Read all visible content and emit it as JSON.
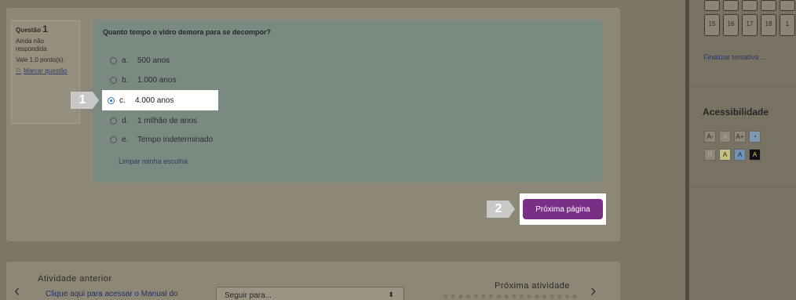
{
  "question": {
    "label": "Questão",
    "number": "1",
    "status": "Ainda não respondida",
    "grade": "Vale 1,0 ponto(s).",
    "flag": "Marcar questão",
    "text": "Quanto tempo o vidro demora para se decompor?",
    "options": [
      {
        "letter": "a.",
        "text": "500 anos",
        "selected": false
      },
      {
        "letter": "b.",
        "text": "1.000 anos",
        "selected": false
      },
      {
        "letter": "c.",
        "text": "4.000 anos",
        "selected": true
      },
      {
        "letter": "d.",
        "text": "1 milhão de anos",
        "selected": false
      },
      {
        "letter": "e.",
        "text": "Tempo indeterminado",
        "selected": false
      }
    ],
    "clear_choice": "Limpar minha escolha"
  },
  "steps": {
    "one": "1",
    "two": "2"
  },
  "next_page_button": "Próxima página",
  "navigation": {
    "prev_title": "Atividade anterior",
    "prev_link": "Clique aqui para acessar o Manual do",
    "goto_placeholder": "Seguir para...",
    "next_title": "Próxima atividade"
  },
  "sidebar": {
    "nav_numbers": [
      "15",
      "16",
      "17",
      "18",
      "1"
    ],
    "finalize": "Finalizar tentativa ...",
    "accessibility_title": "Acessibilidade",
    "acc_row1": [
      "A-",
      "A",
      "A+"
    ],
    "acc_row2": [
      "R",
      "A",
      "A",
      "A"
    ]
  },
  "colors": {
    "accent_purple": "#7a2f86",
    "radio_selected": "#2f6fd6"
  }
}
